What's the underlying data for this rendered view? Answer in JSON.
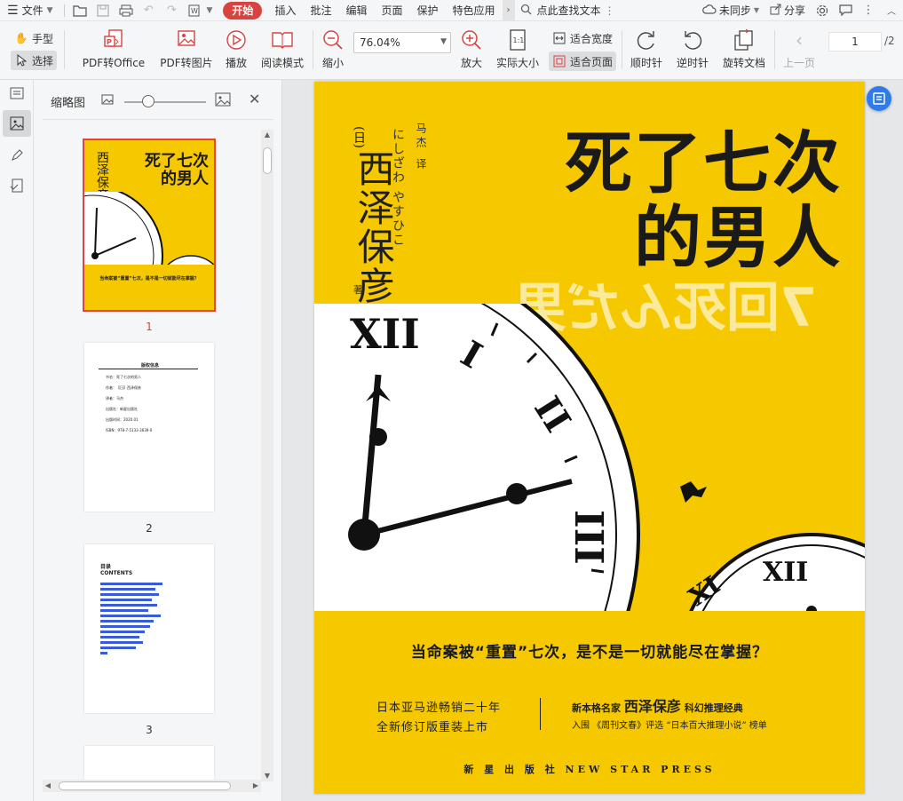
{
  "menubar": {
    "file_label": "文件",
    "start_label": "开始",
    "items": [
      "插入",
      "批注",
      "编辑",
      "页面",
      "保护",
      "特色应用"
    ],
    "search_label": "点此查找文本",
    "sync_label": "未同步",
    "share_label": "分享"
  },
  "ribbon": {
    "hand_label": "手型",
    "select_label": "选择",
    "pdf_to_office": "PDF转Office",
    "pdf_to_image": "PDF转图片",
    "play": "播放",
    "read_mode": "阅读模式",
    "zoom_out": "缩小",
    "zoom_value": "76.04%",
    "zoom_in": "放大",
    "actual_size": "实际大小",
    "fit_width": "适合宽度",
    "fit_page": "适合页面",
    "rotate_cw": "顺时针",
    "rotate_ccw": "逆时针",
    "rotate_doc": "旋转文档",
    "prev_page": "上一页",
    "current_page": "1",
    "total_pages": "/2"
  },
  "thumbnails": {
    "title": "缩略图",
    "pages": [
      {
        "number": "1"
      },
      {
        "number": "2",
        "heading": "版权信息",
        "lines": [
          "书名：死了七次的男人",
          "作者：【日】西泽保彦",
          "译者：马杰",
          "出版社：新星出版社",
          "出版时间：2020.01",
          "ISBN：978-7-5133-3639-0"
        ]
      },
      {
        "number": "3",
        "heading": "目录",
        "heading_en": "CONTENTS"
      }
    ],
    "partial_label": ""
  },
  "cover": {
    "title_line1": "死了七次",
    "title_line2": "的男人",
    "author_prefix": "(日)",
    "author": "西泽保彦",
    "author_jp": "にしざわ やすひこ",
    "translator": "马杰 译",
    "zhu": "著",
    "ghost_text": "7回死んだ男",
    "tagline": "当命案被“重置”七次，是不是一切就能尽在掌握？",
    "left_line1": "日本亚马逊畅销二十年",
    "left_line2": "全新修订版重装上市",
    "right_prefix": "新本格名家",
    "right_name": "西泽保彦",
    "right_suffix": "科幻推理经典",
    "right_line2": "入围 《周刊文春》评选 “日本百大推理小说” 榜单",
    "publisher": "新 星 出 版 社   NEW STAR PRESS"
  },
  "colors": {
    "accent": "#d9433f",
    "cover_yellow": "#f5c800",
    "link_blue": "#3a5bd6"
  }
}
